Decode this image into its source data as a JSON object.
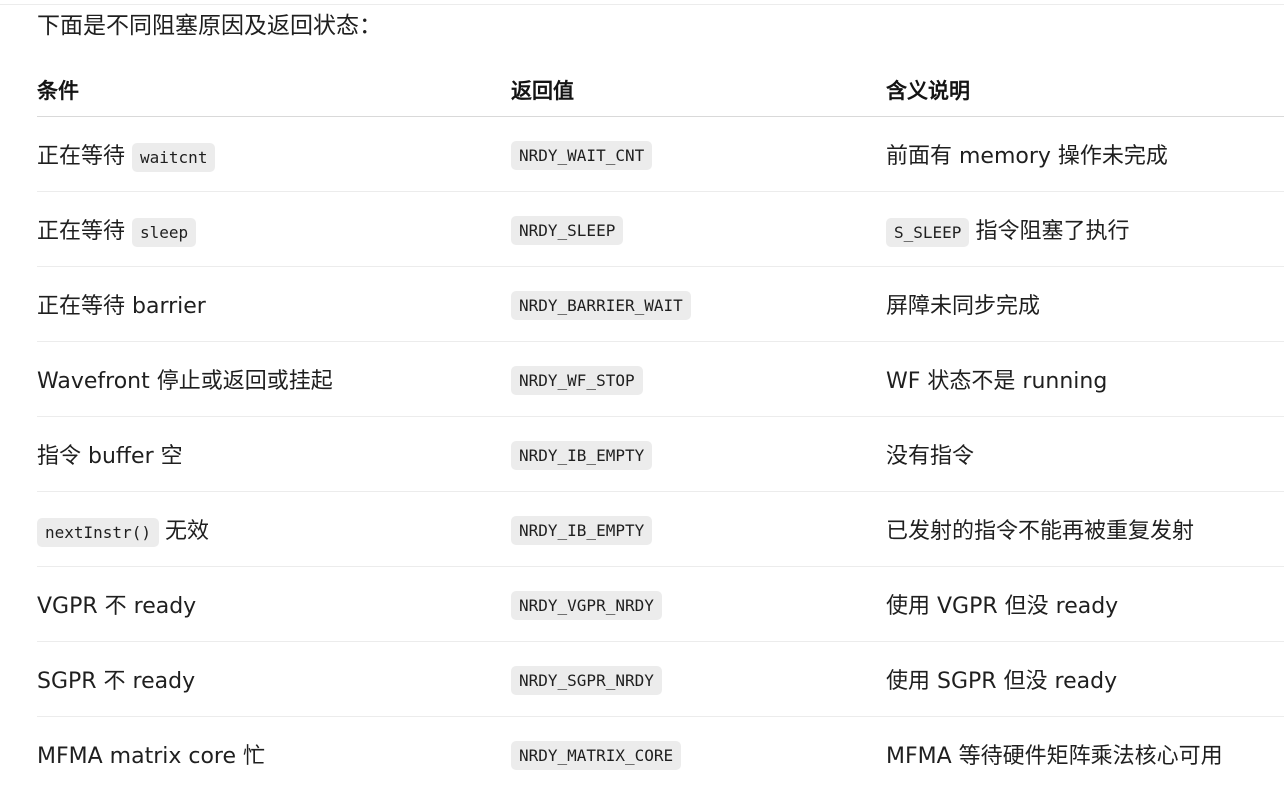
{
  "intro": "下面是不同阻塞原因及返回状态：",
  "table": {
    "headers": [
      "条件",
      "返回值",
      "含义说明"
    ],
    "rows": [
      {
        "condition": {
          "text": "正在等待",
          "code": "waitcnt",
          "suffix": ""
        },
        "return": "NRDY_WAIT_CNT",
        "meaning": {
          "code": "",
          "text": "前面有 memory 操作未完成"
        }
      },
      {
        "condition": {
          "text": "正在等待",
          "code": "sleep",
          "suffix": ""
        },
        "return": "NRDY_SLEEP",
        "meaning": {
          "code": "S_SLEEP",
          "text": "指令阻塞了执行"
        }
      },
      {
        "condition": {
          "text": "正在等待 barrier",
          "code": "",
          "suffix": ""
        },
        "return": "NRDY_BARRIER_WAIT",
        "meaning": {
          "code": "",
          "text": "屏障未同步完成"
        }
      },
      {
        "condition": {
          "text": "Wavefront 停止或返回或挂起",
          "code": "",
          "suffix": ""
        },
        "return": "NRDY_WF_STOP",
        "meaning": {
          "code": "",
          "text": "WF 状态不是 running"
        }
      },
      {
        "condition": {
          "text": "指令 buffer 空",
          "code": "",
          "suffix": ""
        },
        "return": "NRDY_IB_EMPTY",
        "meaning": {
          "code": "",
          "text": "没有指令"
        }
      },
      {
        "condition": {
          "text": "",
          "code": "nextInstr()",
          "suffix": "无效"
        },
        "return": "NRDY_IB_EMPTY",
        "meaning": {
          "code": "",
          "text": "已发射的指令不能再被重复发射"
        }
      },
      {
        "condition": {
          "text": "VGPR 不 ready",
          "code": "",
          "suffix": ""
        },
        "return": "NRDY_VGPR_NRDY",
        "meaning": {
          "code": "",
          "text": "使用 VGPR 但没 ready"
        }
      },
      {
        "condition": {
          "text": "SGPR 不 ready",
          "code": "",
          "suffix": ""
        },
        "return": "NRDY_SGPR_NRDY",
        "meaning": {
          "code": "",
          "text": "使用 SGPR 但没 ready"
        }
      },
      {
        "condition": {
          "text": "MFMA matrix core 忙",
          "code": "",
          "suffix": ""
        },
        "return": "NRDY_MATRIX_CORE",
        "meaning": {
          "code": "",
          "text": "MFMA 等待硬件矩阵乘法核心可用"
        }
      }
    ]
  }
}
